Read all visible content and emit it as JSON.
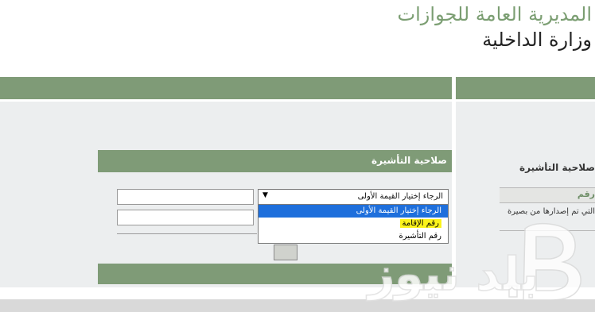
{
  "header": {
    "title": "المديرية العامة للجوازات",
    "subtitle": "وزارة الداخلية"
  },
  "form": {
    "section_title": "صلاحية التأشيرة",
    "select": {
      "selected_value": "الرجاء إختيار القيمة الأولى",
      "options": [
        "الرجاء إختيار القيمة الأولى",
        "رقم الإقامة",
        "رقم التأشيرة"
      ]
    }
  },
  "right_panel": {
    "heading": "صلاحية التأشيرة",
    "row_label": "رقم",
    "description": "التي تم إصدارها من بصيرة"
  },
  "colors": {
    "brand_green": "#7f9b77",
    "panel_gray": "#eceeef",
    "selected_blue": "#1e6fdc",
    "highlight_yellow": "#fbf31b"
  },
  "icons": {
    "dropdown": "triangle-down-icon",
    "watermark": "balad-news-logo"
  },
  "watermark": {
    "text": "بلد نيوز"
  }
}
